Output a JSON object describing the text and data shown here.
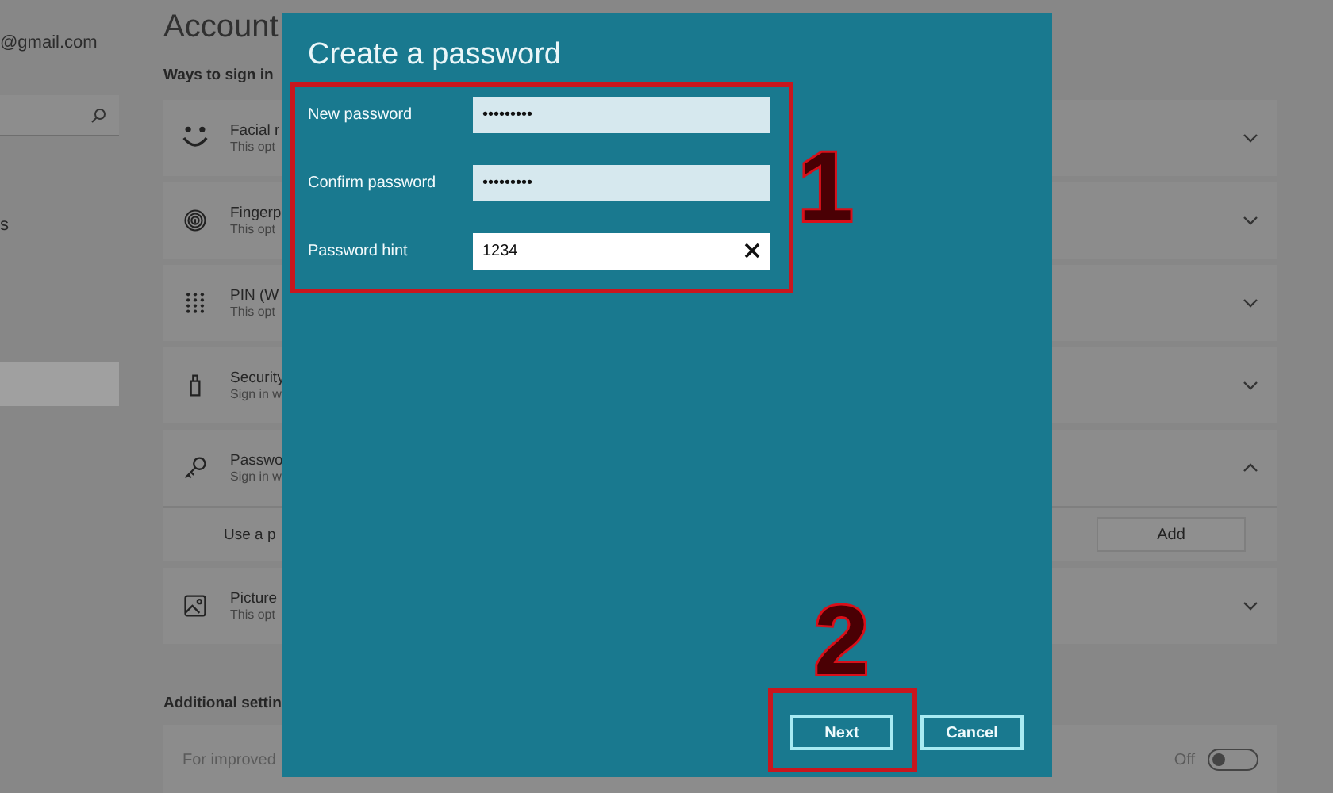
{
  "sidebar": {
    "account_email": "@gmail.com",
    "nav_items": [
      {
        "label": "s",
        "selected": false
      },
      {
        "selected": true
      }
    ]
  },
  "page": {
    "title": "Account",
    "section_title": "Ways to sign in",
    "sign_in_options": [
      {
        "kind": "face",
        "title": "Facial r",
        "subtitle": "This opt",
        "expanded": false
      },
      {
        "kind": "fingerprint",
        "title": "Fingerp",
        "subtitle": "This opt",
        "expanded": false
      },
      {
        "kind": "pin",
        "title": "PIN (W",
        "subtitle": "This opt",
        "expanded": false
      },
      {
        "kind": "security-key",
        "title": "Security",
        "subtitle": "Sign in w",
        "expanded": false
      },
      {
        "kind": "password",
        "title": "Passwo",
        "subtitle": "Sign in w",
        "expanded": true,
        "detail": {
          "text": "Use a p",
          "button": "Add"
        }
      },
      {
        "kind": "picture",
        "title": "Picture",
        "subtitle": "This opt",
        "expanded": false
      }
    ],
    "additional_title": "Additional settin",
    "additional_row": {
      "text": "For improved",
      "toggle_label": "Off",
      "on": false
    }
  },
  "dialog": {
    "title": "Create a password",
    "fields": [
      {
        "label": "New password",
        "value": "•••••••••",
        "focused": false
      },
      {
        "label": "Confirm password",
        "value": "•••••••••",
        "focused": false
      },
      {
        "label": "Password hint",
        "value": "1234",
        "focused": true
      }
    ],
    "buttons": [
      "Next",
      "Cancel"
    ]
  },
  "annotations": [
    "1",
    "2"
  ]
}
